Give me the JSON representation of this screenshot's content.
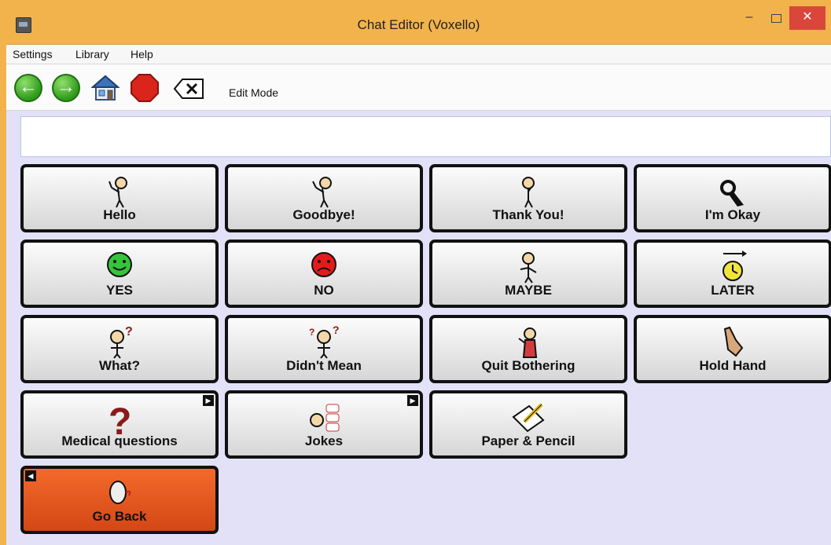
{
  "window": {
    "title": "Chat Editor (Voxello)"
  },
  "menu": {
    "items": [
      "Settings",
      "Library",
      "Help"
    ]
  },
  "toolbar": {
    "edit_mode_label": "Edit Mode"
  },
  "message": {
    "text": ""
  },
  "tiles": [
    {
      "label": "Hello",
      "icon": "waving-person-icon"
    },
    {
      "label": "Goodbye!",
      "icon": "waving-goodbye-person-icon"
    },
    {
      "label": "Thank You!",
      "icon": "thank-you-person-icon"
    },
    {
      "label": "I'm Okay",
      "icon": "ok-hand-icon"
    },
    {
      "label": "YES",
      "icon": "green-smiley-icon",
      "color": "#2ecc40"
    },
    {
      "label": "NO",
      "icon": "red-frowny-icon",
      "color": "#e01b1b"
    },
    {
      "label": "MAYBE",
      "icon": "shrugging-person-icon"
    },
    {
      "label": "LATER",
      "icon": "clock-arrow-icon"
    },
    {
      "label": "What?",
      "icon": "questioning-person-icon"
    },
    {
      "label": "Didn't Mean",
      "icon": "confused-person-icon"
    },
    {
      "label": "Quit Bothering",
      "icon": "stop-bothering-person-icon"
    },
    {
      "label": "Hold Hand",
      "icon": "holding-hands-icon"
    },
    {
      "label": "Medical questions",
      "icon": "question-mark-icon",
      "has_submenu": true
    },
    {
      "label": "Jokes",
      "icon": "jokes-face-icon",
      "has_submenu": true
    },
    {
      "label": "Paper & Pencil",
      "icon": "paper-pencil-icon"
    },
    {
      "label": "Go Back",
      "icon": "go-back-icon",
      "color": "#e85a1f"
    }
  ]
}
